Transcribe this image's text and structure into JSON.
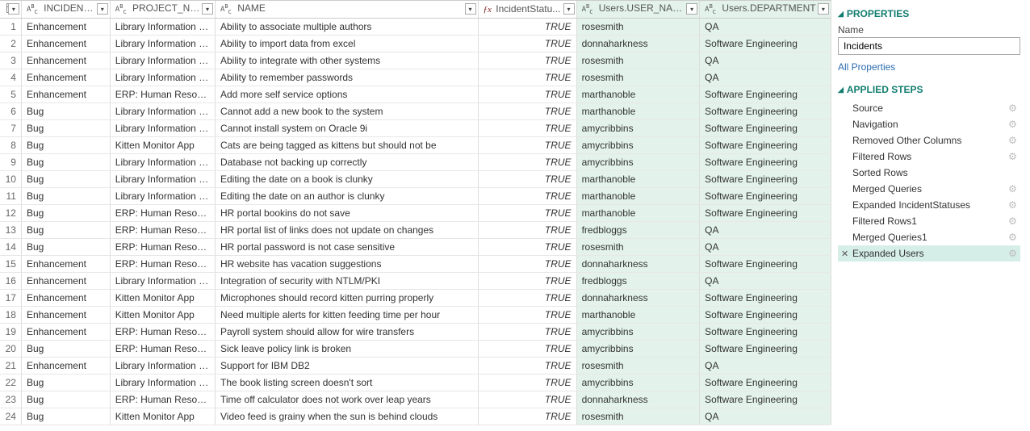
{
  "columns": {
    "incident_type": "INCIDENT_T...",
    "project_name": "PROJECT_NAME",
    "name": "NAME",
    "incident_status": "IncidentStatu...",
    "user_name": "Users.USER_NAME",
    "department": "Users.DEPARTMENT"
  },
  "true_label": "TRUE",
  "rows": [
    {
      "n": "1",
      "type": "Enhancement",
      "proj": "Library Information Sys...",
      "name": "Ability to associate multiple authors",
      "user": "rosesmith",
      "dept": "QA"
    },
    {
      "n": "2",
      "type": "Enhancement",
      "proj": "Library Information Sys...",
      "name": "Ability to import data from excel",
      "user": "donnaharkness",
      "dept": "Software Engineering"
    },
    {
      "n": "3",
      "type": "Enhancement",
      "proj": "Library Information Sys...",
      "name": "Ability to integrate with other systems",
      "user": "rosesmith",
      "dept": "QA"
    },
    {
      "n": "4",
      "type": "Enhancement",
      "proj": "Library Information Sys...",
      "name": "Ability to remember passwords",
      "user": "rosesmith",
      "dept": "QA"
    },
    {
      "n": "5",
      "type": "Enhancement",
      "proj": "ERP: Human Resources",
      "name": "Add more self service options",
      "user": "marthanoble",
      "dept": "Software Engineering"
    },
    {
      "n": "6",
      "type": "Bug",
      "proj": "Library Information Sys...",
      "name": "Cannot add a new book to the system",
      "user": "marthanoble",
      "dept": "Software Engineering"
    },
    {
      "n": "7",
      "type": "Bug",
      "proj": "Library Information Sys...",
      "name": "Cannot install system on Oracle 9i",
      "user": "amycribbins",
      "dept": "Software Engineering"
    },
    {
      "n": "8",
      "type": "Bug",
      "proj": "Kitten Monitor App",
      "name": "Cats are being tagged as kittens but should not be",
      "user": "amycribbins",
      "dept": "Software Engineering"
    },
    {
      "n": "9",
      "type": "Bug",
      "proj": "Library Information Sys...",
      "name": "Database not backing up correctly",
      "user": "amycribbins",
      "dept": "Software Engineering"
    },
    {
      "n": "10",
      "type": "Bug",
      "proj": "Library Information Sys...",
      "name": "Editing the date on a book is clunky",
      "user": "marthanoble",
      "dept": "Software Engineering"
    },
    {
      "n": "11",
      "type": "Bug",
      "proj": "Library Information Sys...",
      "name": "Editing the date on an author is clunky",
      "user": "marthanoble",
      "dept": "Software Engineering"
    },
    {
      "n": "12",
      "type": "Bug",
      "proj": "ERP: Human Resources",
      "name": "HR portal bookins do not save",
      "user": "marthanoble",
      "dept": "Software Engineering"
    },
    {
      "n": "13",
      "type": "Bug",
      "proj": "ERP: Human Resources",
      "name": "HR portal list of links does not update on changes",
      "user": "fredbloggs",
      "dept": "QA"
    },
    {
      "n": "14",
      "type": "Bug",
      "proj": "ERP: Human Resources",
      "name": "HR portal password is not case sensitive",
      "user": "rosesmith",
      "dept": "QA"
    },
    {
      "n": "15",
      "type": "Enhancement",
      "proj": "ERP: Human Resources",
      "name": "HR website has vacation suggestions",
      "user": "donnaharkness",
      "dept": "Software Engineering"
    },
    {
      "n": "16",
      "type": "Enhancement",
      "proj": "Library Information Sys...",
      "name": "Integration of security with NTLM/PKI",
      "user": "fredbloggs",
      "dept": "QA"
    },
    {
      "n": "17",
      "type": "Enhancement",
      "proj": "Kitten Monitor App",
      "name": "Microphones should record kitten purring properly",
      "user": "donnaharkness",
      "dept": "Software Engineering"
    },
    {
      "n": "18",
      "type": "Enhancement",
      "proj": "Kitten Monitor App",
      "name": "Need multiple alerts for kitten feeding time per hour",
      "user": "marthanoble",
      "dept": "Software Engineering"
    },
    {
      "n": "19",
      "type": "Enhancement",
      "proj": "ERP: Human Resources",
      "name": "Payroll system should allow for wire transfers",
      "user": "amycribbins",
      "dept": "Software Engineering"
    },
    {
      "n": "20",
      "type": "Bug",
      "proj": "ERP: Human Resources",
      "name": "Sick leave policy link is broken",
      "user": "amycribbins",
      "dept": "Software Engineering"
    },
    {
      "n": "21",
      "type": "Enhancement",
      "proj": "Library Information Sys...",
      "name": "Support for IBM DB2",
      "user": "rosesmith",
      "dept": "QA"
    },
    {
      "n": "22",
      "type": "Bug",
      "proj": "Library Information Sys...",
      "name": "The book listing screen doesn't sort",
      "user": "amycribbins",
      "dept": "Software Engineering"
    },
    {
      "n": "23",
      "type": "Bug",
      "proj": "ERP: Human Resources",
      "name": "Time off calculator does not work over leap years",
      "user": "donnaharkness",
      "dept": "Software Engineering"
    },
    {
      "n": "24",
      "type": "Bug",
      "proj": "Kitten Monitor App",
      "name": "Video feed is grainy when the sun is behind clouds",
      "user": "rosesmith",
      "dept": "QA"
    }
  ],
  "side": {
    "properties_title": "PROPERTIES",
    "name_label": "Name",
    "name_value": "Incidents",
    "all_properties": "All Properties",
    "steps_title": "APPLIED STEPS",
    "steps": [
      {
        "label": "Source",
        "gear": true,
        "selected": false
      },
      {
        "label": "Navigation",
        "gear": true,
        "selected": false
      },
      {
        "label": "Removed Other Columns",
        "gear": true,
        "selected": false
      },
      {
        "label": "Filtered Rows",
        "gear": true,
        "selected": false
      },
      {
        "label": "Sorted Rows",
        "gear": false,
        "selected": false
      },
      {
        "label": "Merged Queries",
        "gear": true,
        "selected": false
      },
      {
        "label": "Expanded IncidentStatuses",
        "gear": true,
        "selected": false
      },
      {
        "label": "Filtered Rows1",
        "gear": true,
        "selected": false
      },
      {
        "label": "Merged Queries1",
        "gear": true,
        "selected": false
      },
      {
        "label": "Expanded Users",
        "gear": true,
        "selected": true
      }
    ]
  }
}
